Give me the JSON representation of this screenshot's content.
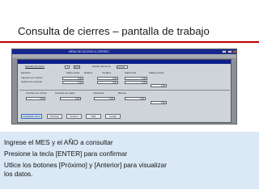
{
  "slide": {
    "title": "Consulta de  cierres – pantalla de trabajo"
  },
  "app": {
    "window_title": "MENU DE ACCESO A CIERRES",
    "panel": {
      "row1": [
        {
          "label": "Mes/año de cierre",
          "value": "4"
        },
        {
          "label": "",
          "value": "2016"
        },
        {
          "label": "Estado del cierre",
          "value": "Cerrado"
        }
      ],
      "headers1": [
        "Mes/año",
        "Saldo inicial",
        "Débitos",
        "Créditos",
        "Saldo final",
        "Saldo período"
      ],
      "rows1": [
        {
          "label": "Ingresos por ventas",
          "values": [
            "0.00",
            "0.00",
            "0.00"
          ]
        },
        {
          "label": "Gastos de compras",
          "values": [
            "0.00",
            "0.00",
            "0.00"
          ]
        }
      ],
      "total1": "0.00",
      "headers2": [
        "Cuentas por cobrar",
        "Cuentas por pagar",
        "Inventario",
        "Bancos"
      ],
      "values2": [
        "0.00",
        "0.00",
        "0.00",
        "0.00"
      ],
      "total2": "0.00",
      "buttons": [
        {
          "label": "Actualizar cierre",
          "active": true
        },
        {
          "label": "Próximo"
        },
        {
          "label": "Anterior"
        },
        {
          "label": "Salir"
        },
        {
          "label": "Ayuda"
        }
      ]
    }
  },
  "notes": [
    "Ingrese el MES y el AÑO a consultar",
    "Presione la tecla [ENTER] para confirmar",
    "Utlice los botones [Próximo] y [Anterior]  para visualizar",
    "los datos."
  ],
  "colors": {
    "accent_rule": "#c00000",
    "titlebar": "#17278f",
    "note_background": "#dbe8f6"
  }
}
